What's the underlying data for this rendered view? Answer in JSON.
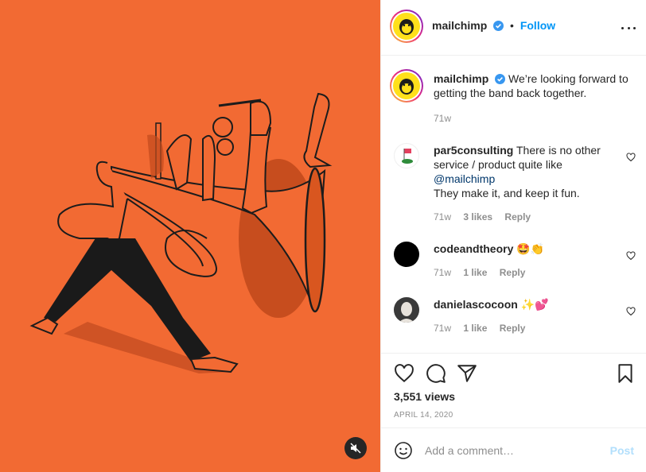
{
  "media": {
    "background": "#f26a33",
    "mute_icon": "speaker-muted-icon"
  },
  "post": {
    "username": "mailchimp",
    "verified_icon": "verified-badge-icon",
    "dot": "•",
    "follow_label": "Follow",
    "more_icon": "more-horizontal-icon",
    "caption": {
      "username": "mailchimp",
      "text": "We’re looking forward to getting the band back together.",
      "time": "71w"
    }
  },
  "comments": [
    {
      "username": "par5consulting",
      "text_before": "There is no other service / product quite like",
      "mention": "@mailchimp",
      "text_after": "They make it, and keep it fun.",
      "time": "71w",
      "likes": "3 likes",
      "reply": "Reply"
    },
    {
      "username": "codeandtheory",
      "emoji": "🤩👏",
      "time": "71w",
      "likes": "1 like",
      "reply": "Reply"
    },
    {
      "username": "danielascocoon",
      "emoji": "✨💕",
      "time": "71w",
      "likes": "1 like",
      "reply": "Reply"
    }
  ],
  "actions": {
    "like_icon": "heart-icon",
    "comment_icon": "comment-icon",
    "share_icon": "paper-plane-icon",
    "save_icon": "bookmark-icon",
    "views": "3,551 views",
    "date": "APRIL 14, 2020"
  },
  "add_comment": {
    "emoji_icon": "smiley-icon",
    "placeholder": "Add a comment…",
    "post_label": "Post"
  },
  "colors": {
    "accent": "#0095f6",
    "post_disabled": "#b2dffc",
    "muted_text": "#8e8e8e",
    "brand_yellow": "#ffe01b"
  }
}
